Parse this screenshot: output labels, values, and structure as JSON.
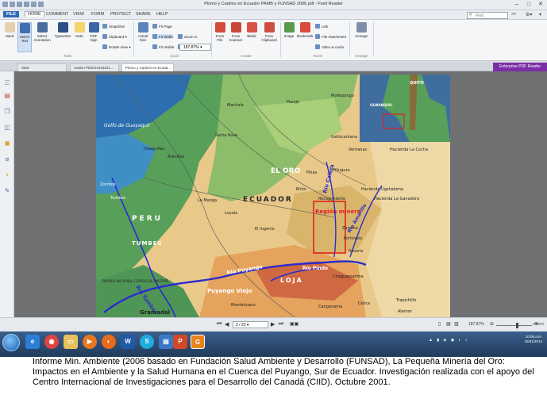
{
  "window": {
    "title": "Plomo y Cadmio en Ecuador PAMB y FUNSAD 2006.pdf - Foxit Reader"
  },
  "menu": {
    "file": "FILE",
    "home": "HOME",
    "comment": "COMMENT",
    "view": "VIEW",
    "form": "FORM",
    "protect": "PROTECT",
    "share": "SHARE",
    "help": "HELP"
  },
  "find": {
    "placeholder": "Find"
  },
  "ribbon": {
    "hand": "Hand",
    "select_text": "Select Text",
    "select_annotation": "Select Annotation",
    "typewriter": "Typewriter",
    "note": "Note",
    "pdf_sign": "PDF Sign",
    "snapshot": "SnapShot",
    "clipboard": "Clipboard",
    "rotate_view": "Rotate View",
    "actual_size": "Actual Size",
    "fit_page": "Fit Page",
    "fit_width": "Fit Width",
    "fit_visible": "Fit Visible",
    "zoom_value": "187.87%",
    "zoom_in": "Zoom In",
    "zoom_out": "Zoom Out",
    "from_file": "From File",
    "from_scanner": "From Scanner",
    "blank": "Blank",
    "from_clipboard": "From Clipboard",
    "image": "Image",
    "bookmark": "Bookmark",
    "link": "Link",
    "file_attachment": "File Attachment",
    "video_audio": "Video & Audio",
    "arrange": "Arrange",
    "group_tools": "Tools",
    "group_zoom": "Zoom",
    "group_create": "Create",
    "group_insert": "Insert",
    "group_arrange": "Arrange"
  },
  "tabs": [
    "Start",
    "Autism PDD/14444221...",
    "Plomo y Cadmio en Ecuad..."
  ],
  "enterprise": "Enterprise PDF Reader",
  "map": {
    "golfo": "Golfo de Guayaquil",
    "el_oro": "EL ORO",
    "ecuador": "ECUADOR",
    "peru": "PERU",
    "tumbes": "TUMBES",
    "loja": "LOJA",
    "region_minera": "Región minera",
    "rio_calera": "Río Calera",
    "rio_amarillo": "Río Amarillo",
    "rio_puyango": "Río Puyango",
    "rio_pindo": "Río Pindo",
    "rio_tumbes": "Río Tumbes",
    "quito": "QUITO",
    "guayaquil": "GUAYAQUIL",
    "machala": "Machala",
    "pasaje": "Pasaje",
    "santa_rosa": "Santa Rosa",
    "zaruma": "Zaruma",
    "portovelo": "Portovelo",
    "pinas": "Piñas",
    "arenillas": "Arenillas",
    "huaquillas": "Huaquillas",
    "puyango_viejo": "Puyango Viejo",
    "gramadal": "Gramadal",
    "celica": "Celica",
    "alamor": "Alamor",
    "ventanas": "Ventanas",
    "hda_cocha": "Hacienda La Cocha",
    "pilluguro": "Pilluguro",
    "hda_ugshaloma": "Hacienda Ugshaloma",
    "hda_ganadera": "Hacienda La Ganadera",
    "tumbes_city": "Tumbes",
    "zorritos": "Zorritos",
    "la_manga": "La Manga",
    "loyola": "Loyola",
    "el_ingenio": "El Ingenio",
    "biron": "Birón",
    "recogimiento": "Recogimiento",
    "rosario": "Rosario",
    "montehuaco": "Montehuaco",
    "cangonama": "Cangonama",
    "trapichillo": "Trapichillo",
    "chaguarpamba": "Chaguarpamba",
    "mollepongo": "Mollepongo",
    "gallocantana": "Gallocantana",
    "parque": "PARQUE NACIONAL CERROS DE AMOTAPE"
  },
  "status": {
    "page": "3 / 22",
    "zoom": "187.87%",
    "zotero": "zotero"
  },
  "taskbar": {
    "time": "10:05 a.m.",
    "date": "16/01/2014"
  },
  "caption": "Informe Min. Ambiente (2006 basado en Fundación Salud Ambiente y Desarrollo (FUNSAD), La Pequeña Minería del Oro: Impactos en el Ambiente y la Salud Humana en el Cuenca del Puyango, Sur de Ecuador. Investigación realizada con el  apoyo del Centro Internacional de Investigaciones para el Desarrollo del Canadá (CIID). Octubre 2001."
}
